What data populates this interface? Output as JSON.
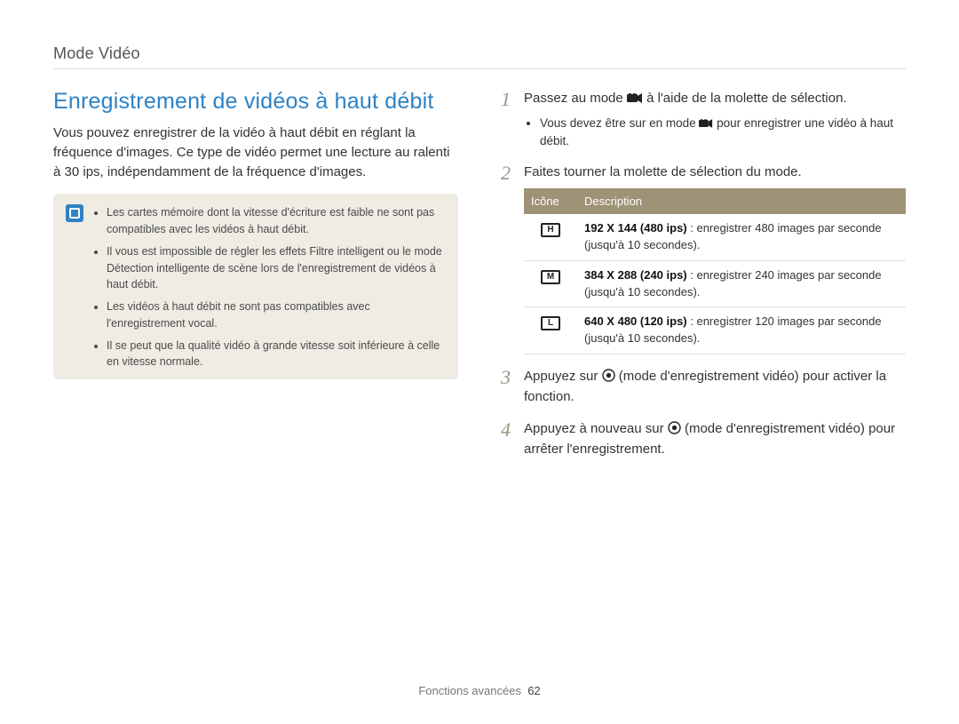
{
  "header": {
    "title": "Mode Vidéo"
  },
  "left": {
    "section_title": "Enregistrement de vidéos à haut débit",
    "intro": "Vous pouvez enregistrer de la vidéo à haut débit en réglant la fréquence d'images. Ce type de vidéo permet une lecture au ralenti à 30 ips, indépendamment de la fréquence d'images.",
    "notes": [
      "Les cartes mémoire dont la vitesse d'écriture est faible ne sont pas compatibles avec les vidéos à haut débit.",
      "Il vous est impossible de régler les effets Filtre intelligent ou le mode Détection intelligente de scène lors de l'enregistrement de vidéos à haut débit.",
      "Les vidéos à haut débit ne sont pas compatibles avec l'enregistrement vocal.",
      "Il se peut que la qualité vidéo à grande vitesse soit inférieure à celle en vitesse normale."
    ]
  },
  "steps": {
    "s1": {
      "num": "1",
      "text_a": "Passez au mode ",
      "text_b": " à l'aide de la molette de sélection.",
      "sub_a": "Vous devez être sur en mode ",
      "sub_b": " pour enregistrer une vidéo à haut débit."
    },
    "s2": {
      "num": "2",
      "text": "Faites tourner la molette de sélection du mode."
    },
    "s3": {
      "num": "3",
      "text_a": "Appuyez sur ",
      "text_b": " (mode d'enregistrement vidéo) pour activer la fonction."
    },
    "s4": {
      "num": "4",
      "text_a": "Appuyez à nouveau sur ",
      "text_b": " (mode d'enregistrement vidéo) pour arrêter l'enregistrement."
    }
  },
  "table": {
    "head_icon": "Icône",
    "head_desc": "Description",
    "rows": [
      {
        "letter": "H",
        "bold": "192 X 144 (480 ips)",
        "rest": " : enregistrer 480 images par seconde (jusqu'à 10 secondes)."
      },
      {
        "letter": "M",
        "bold": "384 X 288 (240 ips)",
        "rest": " : enregistrer 240 images par seconde (jusqu'à 10 secondes)."
      },
      {
        "letter": "L",
        "bold": "640 X 480 (120 ips)",
        "rest": " : enregistrer 120 images par seconde (jusqu'à 10 secondes)."
      }
    ]
  },
  "footer": {
    "section": "Fonctions avancées",
    "page": "62"
  }
}
